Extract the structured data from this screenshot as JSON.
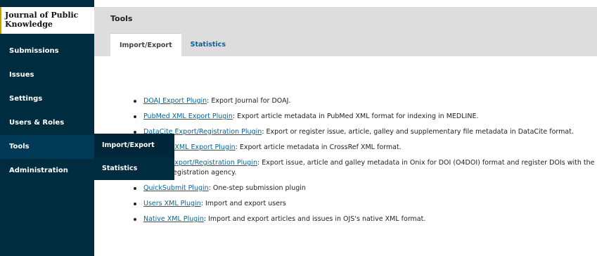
{
  "brand": {
    "name": "Journal of Public Knowledge"
  },
  "sidebar": {
    "items": [
      {
        "label": "Submissions"
      },
      {
        "label": "Issues"
      },
      {
        "label": "Settings"
      },
      {
        "label": "Users & Roles"
      },
      {
        "label": "Tools"
      },
      {
        "label": "Administration"
      }
    ]
  },
  "flyout": {
    "items": [
      {
        "label": "Import/Export"
      },
      {
        "label": "Statistics"
      }
    ]
  },
  "header": {
    "title": "Tools",
    "tabs": [
      {
        "label": "Import/Export"
      },
      {
        "label": "Statistics"
      }
    ]
  },
  "plugins": [
    {
      "link": "DOAJ Export Plugin",
      "desc": ": Export Journal for DOAJ."
    },
    {
      "link": "PubMed XML Export Plugin",
      "desc": ": Export article metadata in PubMed XML format for indexing in MEDLINE."
    },
    {
      "link": "DataCite Export/Registration Plugin",
      "desc": ": Export or register issue, article, galley and supplementary file metadata in DataCite format."
    },
    {
      "link": "CrossRef XML Export Plugin",
      "desc": ": Export article metadata in CrossRef XML format."
    },
    {
      "link": "mEDRA Export/Registration Plugin",
      "desc": ": Export issue, article and galley metadata in Onix for DOI (O4DOI) format and register DOIs with the mEDRA registration agency."
    },
    {
      "link": "QuickSubmit Plugin",
      "desc": ": One-step submission plugin"
    },
    {
      "link": "Users XML Plugin",
      "desc": ": Import and export users"
    },
    {
      "link": "Native XML Plugin",
      "desc": ": Import and export articles and issues in OJS's native XML format."
    }
  ],
  "colors": {
    "sidebar_bg": "#002c40",
    "link": "#006798",
    "header_bg": "#dddddd"
  }
}
